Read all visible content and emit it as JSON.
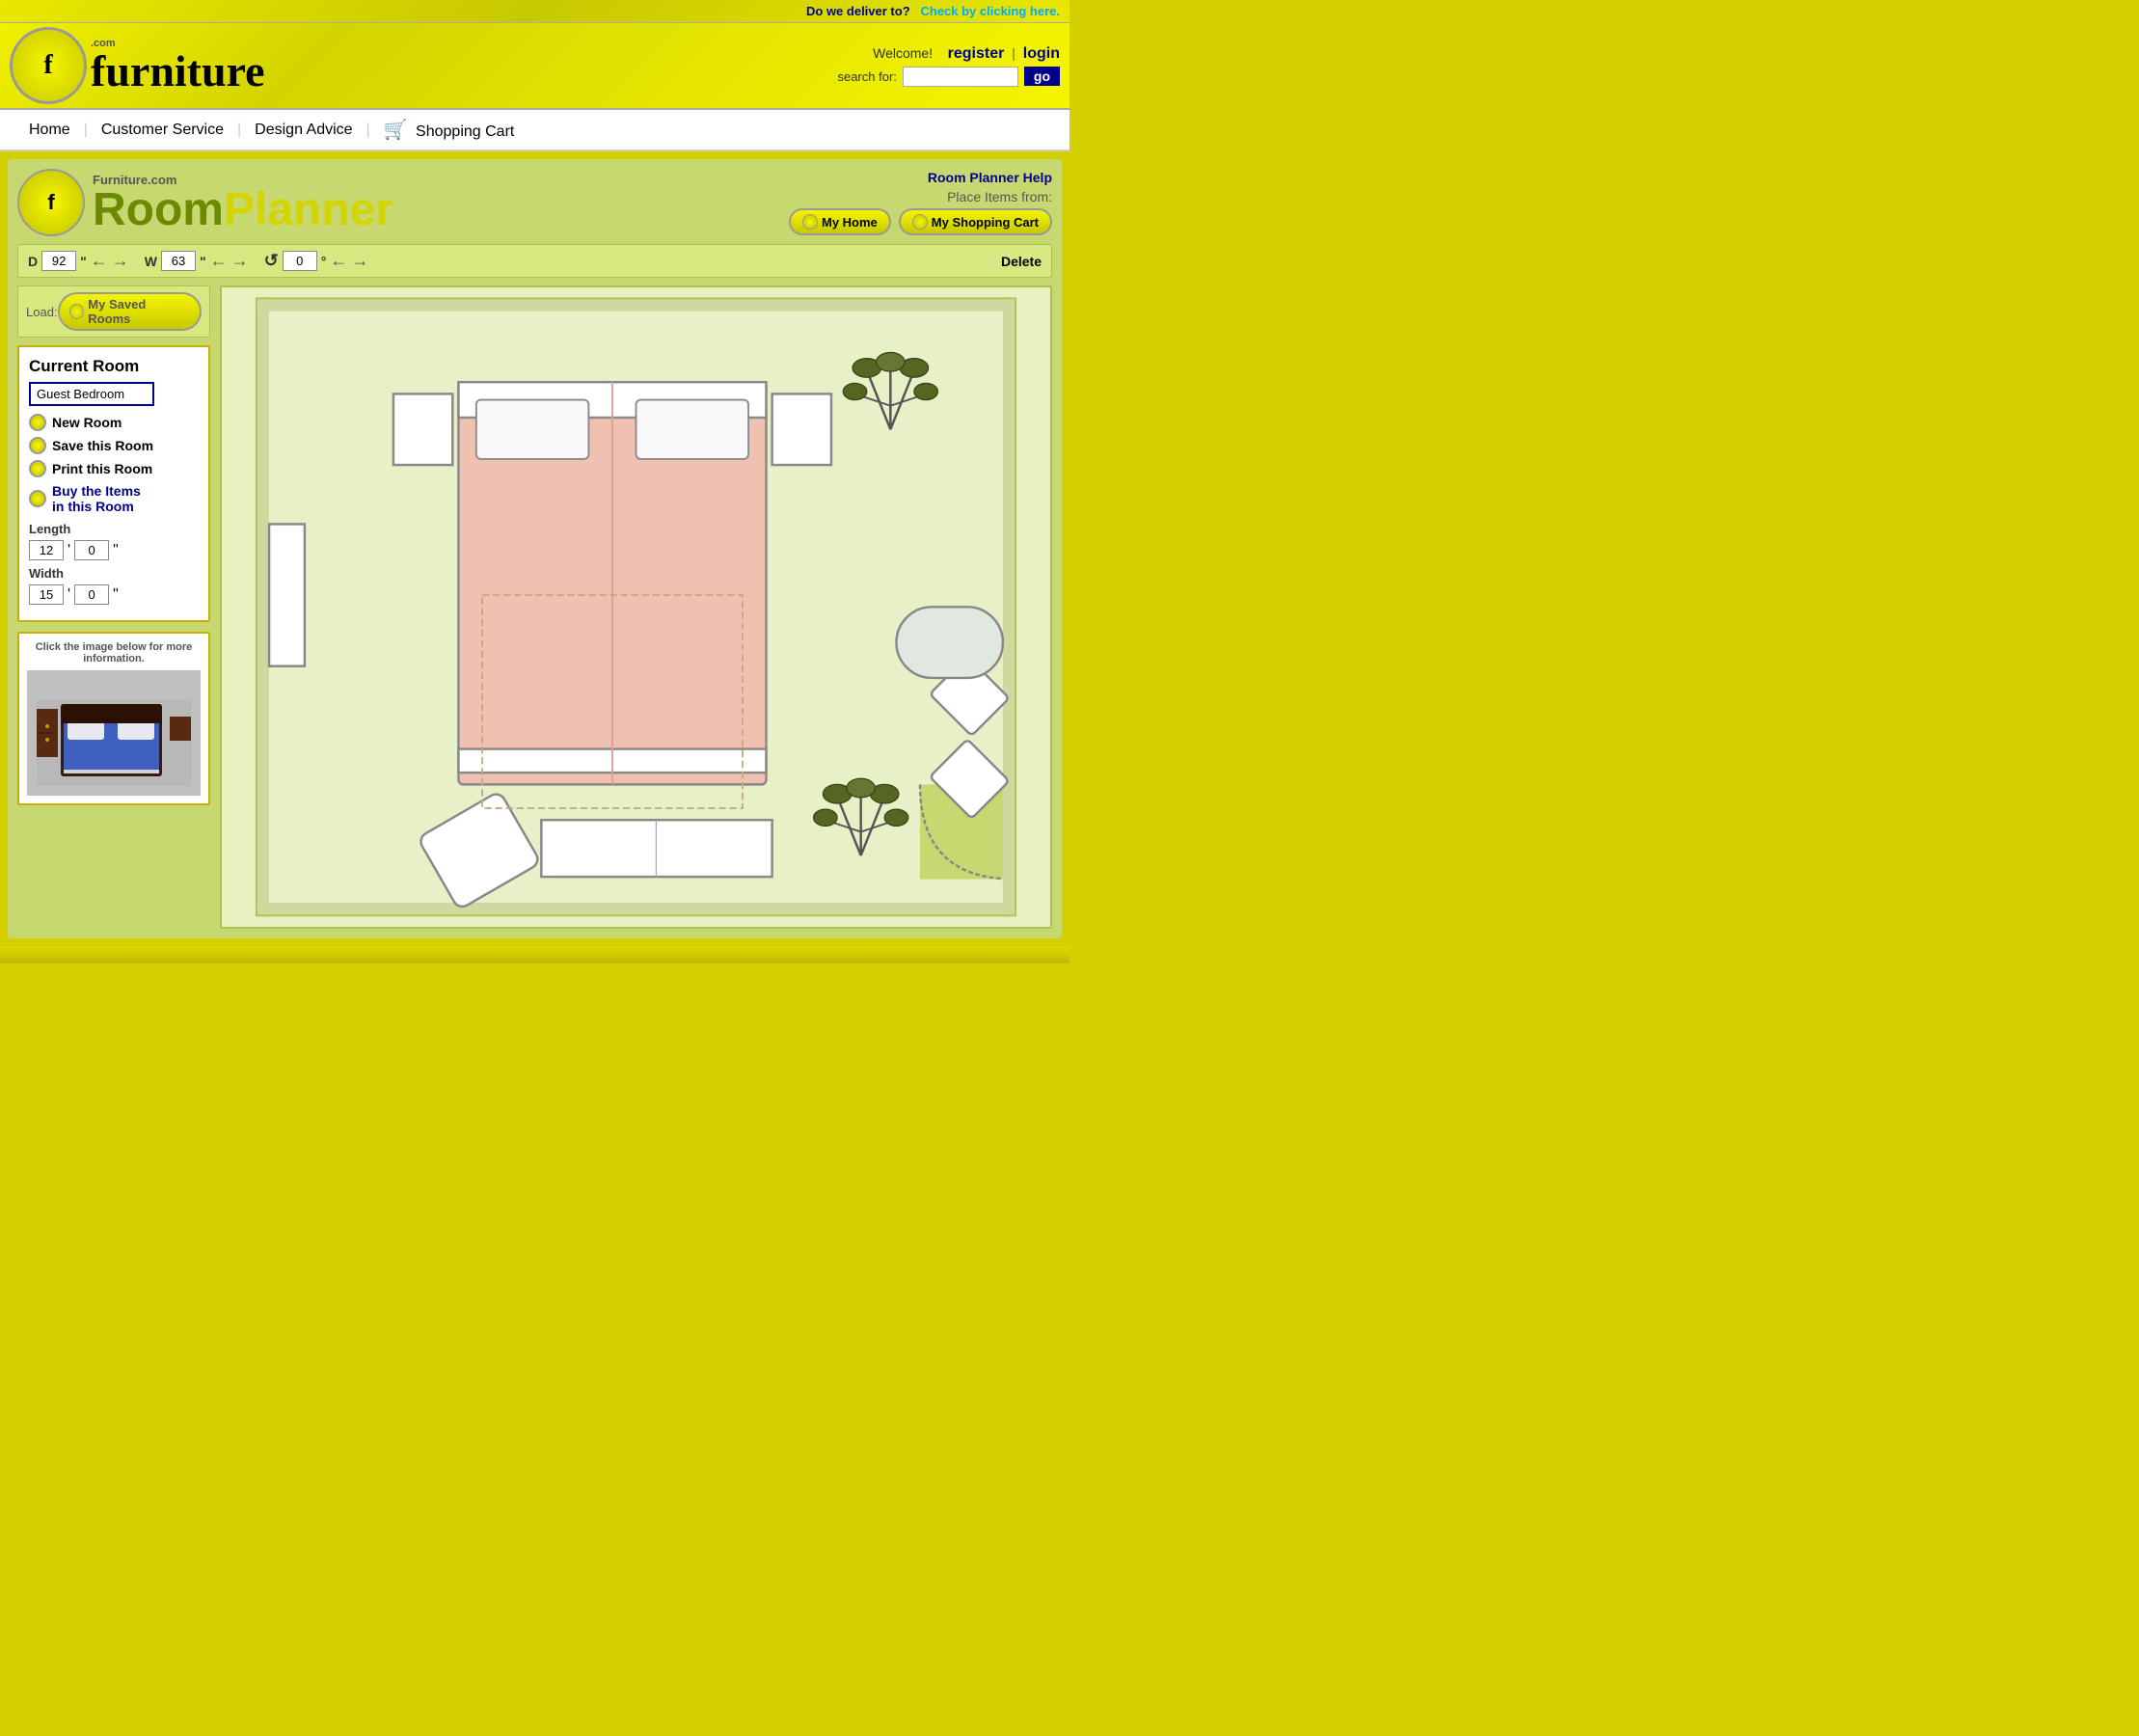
{
  "topbar": {
    "deliver_text": "Do we deliver to?",
    "check_link": "Check by clicking here."
  },
  "header": {
    "logo_com": ".com",
    "logo_furniture": "furniture",
    "welcome": "Welcome!",
    "register": "register",
    "pipe": "|",
    "login": "login",
    "search_label": "search for:",
    "search_placeholder": "",
    "go_label": "go"
  },
  "nav": {
    "items": [
      {
        "label": "Home",
        "href": "#"
      },
      {
        "label": "Customer Service",
        "href": "#"
      },
      {
        "label": "Design Advice",
        "href": "#"
      },
      {
        "label": "Shopping Cart",
        "href": "#"
      }
    ],
    "cart_icon": "🛒"
  },
  "planner": {
    "title_small": "Furniture.com",
    "title_room": "Room",
    "title_planner": "Planner",
    "help_label": "Room Planner Help",
    "place_items_label": "Place Items from:",
    "my_home_label": "My Home",
    "my_shopping_cart_label": "My Shopping Cart",
    "controls": {
      "d_label": "D",
      "d_value": "92",
      "d_unit": "\"",
      "w_label": "W",
      "w_value": "63",
      "w_unit": "\"",
      "rotate_value": "0",
      "rotate_unit": "°",
      "delete_label": "Delete"
    },
    "load": {
      "label": "Load:",
      "button": "My Saved Rooms"
    },
    "current_room": {
      "title": "Current Room",
      "name_value": "Guest Bedroom",
      "options": [
        {
          "label": "New Room"
        },
        {
          "label": "Save this Room"
        },
        {
          "label": "Print this Room"
        },
        {
          "label": "Buy the Items\nin this Room",
          "blue": true
        }
      ],
      "length_label": "Length",
      "length_ft": "12",
      "length_in": "0",
      "width_label": "Width",
      "width_ft": "15",
      "width_in": "0"
    },
    "preview": {
      "label": "Click the image below for more information."
    }
  }
}
